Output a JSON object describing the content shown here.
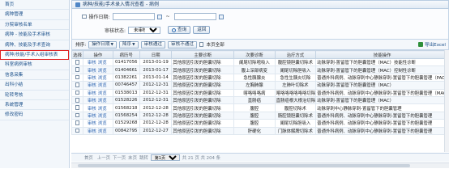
{
  "sidebar": {
    "items": [
      {
        "label": "首页",
        "active": false
      },
      {
        "label": "病种管理",
        "active": false
      },
      {
        "label": "分院审核名单",
        "active": false
      },
      {
        "label": "病种 - 技能及手术审核",
        "active": false
      },
      {
        "label": "病种、技能及手术查询",
        "active": false
      },
      {
        "label": "病种/技能/手术入组审核表",
        "active": true
      },
      {
        "label": "科室病例审核",
        "active": false
      },
      {
        "label": "信息采集",
        "active": false
      },
      {
        "label": "出科小结",
        "active": false
      },
      {
        "label": "轮转考核",
        "active": false
      },
      {
        "label": "系统管理",
        "active": false
      },
      {
        "label": "修改密码",
        "active": false
      }
    ]
  },
  "title": "病种/技能/手术录入情况查看 - 病例",
  "filter": {
    "date_label": "操作日期:",
    "date_from": "",
    "date_to": "",
    "status_label": "审核状态:",
    "status_value": "未审核",
    "query_label": "查询",
    "back_label": "返回"
  },
  "toolbar": {
    "sort_label": "排序:",
    "sort_field": "操作日期",
    "sort_order": "降序",
    "approve_label": "审核通过",
    "reject_label": "审核不通过",
    "current_page_label": "本页全部",
    "export_label": "导出Excel"
  },
  "table": {
    "headers": [
      "选择",
      "操作",
      "病历号",
      "日期",
      "主要诊断",
      "次要诊断",
      "治疗方式",
      "技能操作"
    ],
    "rows": [
      {
        "op1": "审核",
        "op2": "浏览",
        "id": "01417056",
        "date": "2013-01-19",
        "main": "其他原因引发的胆囊切除",
        "sub": "阑尾切除嘧吸入",
        "treat": "腹腔镜胆囊切除术",
        "skill": "动脉穿刺-置留管下的胆囊管理（MAC）技能性诊断"
      },
      {
        "op1": "审核",
        "op2": "浏览",
        "id": "01404661",
        "date": "2013-01-17",
        "main": "其他原因引发的胆囊切除",
        "sub": "腹上深部病变",
        "treat": "阑尾切除胆吸入",
        "skill": "动脉穿刺-置留管下的胆囊管理（MAC）控制性诊断"
      },
      {
        "op1": "审核",
        "op2": "浏览",
        "id": "01382261",
        "date": "2013-01-14",
        "main": "其他原因引发的胆囊切除",
        "sub": "急性胰腺炎",
        "treat": "急性生胰炎切除",
        "skill": "普通外科病例、动脉穿刺中心静脉穿刺-置留管下的胆囊管理（PACU）"
      },
      {
        "op1": "审核",
        "op2": "浏览",
        "id": "00746457",
        "date": "2012-12-31",
        "main": "其他原因引发的胆囊切除",
        "sub": "左胸肺腺",
        "treat": "左肺叶切除术",
        "skill": "动脉穿刺-置留管下的胆囊管理（MAC）"
      },
      {
        "op1": "审核",
        "op2": "浏览",
        "id": "01538013",
        "date": "2012-12-31",
        "main": "其他原因引发的胆囊切除",
        "sub": "喀咯咯咯病",
        "treat": "喀咯咯咯咯咯咯切除",
        "skill": "普通外科病例、动脉穿刺中心静脉穿刺-置留管下的胆囊管理（MAC）"
      },
      {
        "op1": "审核",
        "op2": "浏览",
        "id": "01528226",
        "date": "2012-12-31",
        "main": "其他原因引发的胆囊切除",
        "sub": "直肠癌",
        "treat": "直肠癌根大根治切除",
        "skill": "动脉穿刺-置留管下的胆囊管理（MAC）"
      },
      {
        "op1": "审核",
        "op2": "浏览",
        "id": "01568218",
        "date": "2012-12-28",
        "main": "其他原因引发的胆囊切除",
        "sub": "腹腔",
        "treat": "腹腔切除术",
        "skill": "动脉穿刺中心静脉穿刺-置留管下的胆囊管理"
      },
      {
        "op1": "审核",
        "op2": "浏览",
        "id": "01568254",
        "date": "2012-12-28",
        "main": "其他原因引发的胆囊切除",
        "sub": "腹腔",
        "treat": "肠腔镜胆囊切除术",
        "skill": "普通外科病例、动脉穿刺中心静脉穿刺-置留管下的胆囊管理"
      },
      {
        "op1": "审核",
        "op2": "浏览",
        "id": "01529268",
        "date": "2012-12-28",
        "main": "其他原因引发的胆囊切除",
        "sub": "腹腔",
        "treat": "阑尾切除胆吸入",
        "skill": "普通外科病例、动脉穿刺中心静脉穿刺-置留管下的胆囊管理"
      },
      {
        "op1": "审核",
        "op2": "浏览",
        "id": "00842795",
        "date": "2012-12-27",
        "main": "其他原因引发的胆囊切除",
        "sub": "肝硬化",
        "treat": "门脉体解脾切除术",
        "skill": "普通外科病例、动脉穿刺中心静脉穿刺-置留管下的胆囊管理"
      }
    ]
  },
  "pager": {
    "first": "首页",
    "prev": "上一页",
    "next": "下一页",
    "last": "末页",
    "jump_label": "跳转",
    "page_label": "第1页",
    "summary": "共 21 页 共 204 条"
  }
}
